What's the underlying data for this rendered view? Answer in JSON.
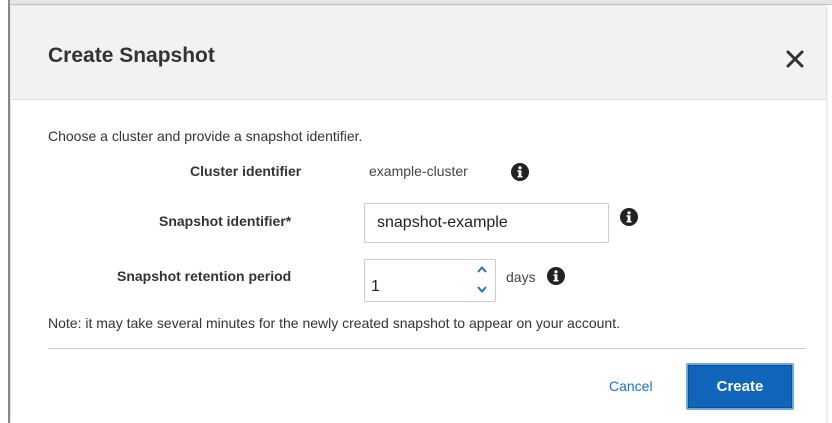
{
  "dialog": {
    "title": "Create Snapshot",
    "close_icon": "close-icon",
    "intro": "Choose a cluster and provide a snapshot identifier.",
    "cluster": {
      "label": "Cluster identifier",
      "value": "example-cluster"
    },
    "snapshot_identifier": {
      "label": "Snapshot identifier*",
      "value": "snapshot-example"
    },
    "retention": {
      "label": "Snapshot retention period",
      "value": "1",
      "unit": "days"
    },
    "note": "Note: it may take several minutes for the newly created snapshot to appear on your account.",
    "cancel_label": "Cancel",
    "create_label": "Create"
  },
  "icons": {
    "info": "info-icon",
    "step_up": "chevron-up-icon",
    "step_down": "chevron-down-icon"
  },
  "colors": {
    "header_bg": "#f2f2f2",
    "link": "#1a73c9",
    "primary_button": "#1166bb",
    "step_arrow": "#1a73c9"
  }
}
